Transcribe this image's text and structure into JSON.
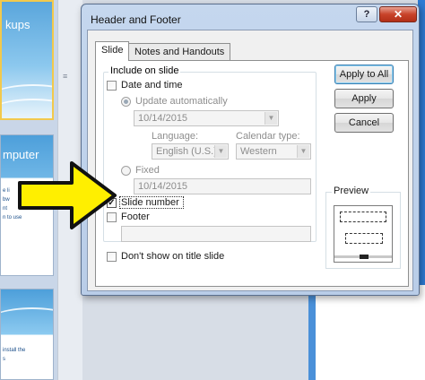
{
  "background": {
    "slide1_title": "kups",
    "slide2_title": "mputer",
    "slide2_lines": [
      "e li",
      "bw",
      "nt",
      "n to use"
    ],
    "slide3_lines": [
      "install the",
      "s"
    ]
  },
  "dialog": {
    "title": "Header and Footer",
    "help_label": "?",
    "close_label": "✕",
    "tabs": [
      {
        "label": "Slide",
        "selected": true
      },
      {
        "label": "Notes and Handouts",
        "selected": false
      }
    ],
    "group_label": "Include on slide",
    "date_time": {
      "label": "Date and time",
      "checked": false
    },
    "update_auto": {
      "label": "Update automatically",
      "selected": true,
      "value": "10/14/2015"
    },
    "language": {
      "label": "Language:",
      "value": "English (U.S.)"
    },
    "calendar": {
      "label": "Calendar type:",
      "value": "Western"
    },
    "fixed": {
      "label": "Fixed",
      "selected": false,
      "value": "10/14/2015"
    },
    "slide_number": {
      "label": "Slide number",
      "checked": true
    },
    "footer": {
      "label": "Footer",
      "checked": false,
      "value": ""
    },
    "dont_show": {
      "label": "Don't show on title slide",
      "checked": false
    },
    "buttons": {
      "apply_all": "Apply to All",
      "apply": "Apply",
      "cancel": "Cancel"
    },
    "preview_label": "Preview"
  },
  "annotation": {
    "arrow_color": "#ffef00",
    "arrow_outline": "#111111"
  }
}
